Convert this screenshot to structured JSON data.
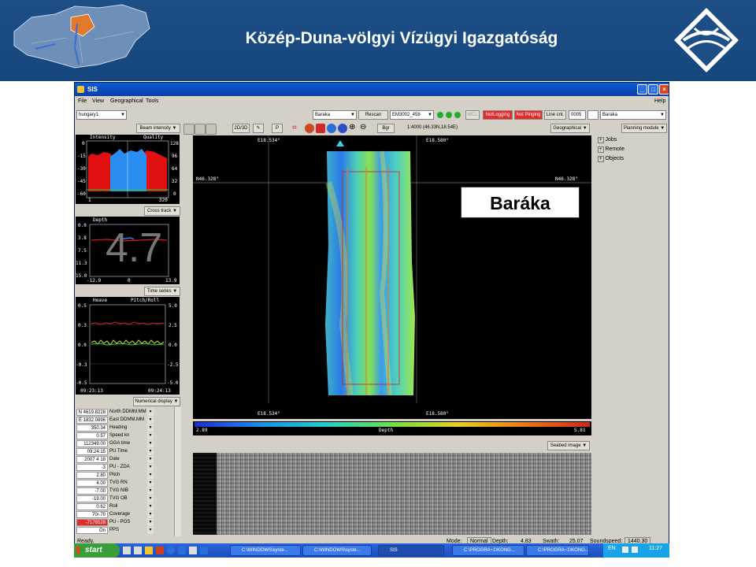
{
  "slide": {
    "title": "Közép-Duna-völgyi Vízügyi Igazgatóság",
    "callout": "Baráka"
  },
  "window": {
    "title": "SIS",
    "menu": [
      "File",
      "View",
      "Geographical",
      "Tools"
    ],
    "help": "Help"
  },
  "toolbar": {
    "project": "hungary1",
    "survey": "Baraka",
    "rescan": "Rescan",
    "sonar": "EM3002_458",
    "wcl": "WCL",
    "not_logging": "NotLogging",
    "not_pinging": "Not Pinging",
    "line_cnt_label": "Line cnt.",
    "line_cnt_value": "0005",
    "line_name": "Baraka",
    "view_2d3d": "2D/3D",
    "p": "P",
    "bgr": "Bgr",
    "scale": "1:4000 (46.33N,18.54E)",
    "geographical": "Geographical",
    "planning": "Planning module",
    "beam_intensity": "Beam intensity",
    "cross_track": "Cross track",
    "time_series": "Time series",
    "numerical_display": "Numerical display",
    "seabed_image": "Seabed image"
  },
  "beam_panel": {
    "title_left": "Intensity",
    "title_right": "Quality",
    "y_left": [
      "0",
      "-15",
      "-30",
      "-45",
      "-60"
    ],
    "y_right": [
      "128",
      "96",
      "64",
      "32",
      "0"
    ],
    "x": [
      "1",
      "320"
    ]
  },
  "depth_panel": {
    "title": "Depth",
    "y": [
      "0.0",
      "3.8",
      "7.5",
      "11.3",
      "15.0"
    ],
    "x": [
      "-12.9",
      "0",
      "13.9"
    ],
    "big_value": "4.7"
  },
  "series_panel": {
    "title_left": "Heave",
    "title_right": "Pitch/Roll",
    "y_left": [
      "0.5",
      "0.3",
      "0.0",
      "-0.3",
      "-0.5"
    ],
    "y_right": [
      "5.0",
      "2.5",
      "0.0",
      "-2.5",
      "-5.0"
    ],
    "t_start": "09:23:13",
    "t_end": "09:24:13"
  },
  "map": {
    "tl": "E18.534°",
    "tr": "E18.580°",
    "bl": "E18.534°",
    "br": "E18.580°",
    "lat_left": "N46.328°",
    "lat_right": "N46.328°",
    "depth_min": "2.89",
    "depth_label": "Depth",
    "depth_max": "5.81",
    "colors": [
      "#1c2bd4",
      "#1d8ee8",
      "#1fd0c8",
      "#6ee04a",
      "#e8d020",
      "#e87a1e",
      "#cc2a1a"
    ]
  },
  "tree": [
    "Jobs",
    "Remote",
    "Objects"
  ],
  "numerical": [
    {
      "value": "N 4619.8228",
      "label": "North DDMM.MM"
    },
    {
      "value": "E 1832.0896",
      "label": "East DDMM.MM"
    },
    {
      "value": "350.34",
      "label": "Heading"
    },
    {
      "value": "0.57",
      "label": "Speed kn"
    },
    {
      "value": "112349.00",
      "label": "GGA time"
    },
    {
      "value": "09:24:15",
      "label": "PU Time"
    },
    {
      "value": "2007 4 18",
      "label": "Date"
    },
    {
      "value": "-3",
      "label": "PU - ZDA"
    },
    {
      "value": "2.80",
      "label": "Pitch"
    },
    {
      "value": "4.00",
      "label": "TVG RN"
    },
    {
      "value": "-7.00",
      "label": "TVG NIB"
    },
    {
      "value": "-19.00",
      "label": "TVG OB"
    },
    {
      "value": "0.62",
      "label": "Roll"
    },
    {
      "value": "70/-70",
      "label": "Coverage"
    },
    {
      "value": "-7176528",
      "label": "PU - POS"
    },
    {
      "value": "On",
      "label": "PPS"
    }
  ],
  "status": {
    "ready": "Ready.",
    "mode_label": "Mode:",
    "mode": "Normal",
    "depth_label": "Depth:",
    "depth": "4.83",
    "swath_label": "Swath:",
    "swath": "25.07",
    "soundspeed_label": "Soundspeed:",
    "soundspeed": "1440.30"
  },
  "taskbar": {
    "start": "start",
    "tasks": [
      "C:\\WINDOWS\\syste...",
      "C:\\WINDOWS\\syste...",
      "SIS",
      "C:\\PROGRA~1\\KONG...",
      "C:\\PROGRA~1\\KONG..."
    ],
    "lang": "EN",
    "clock": "11:27"
  }
}
